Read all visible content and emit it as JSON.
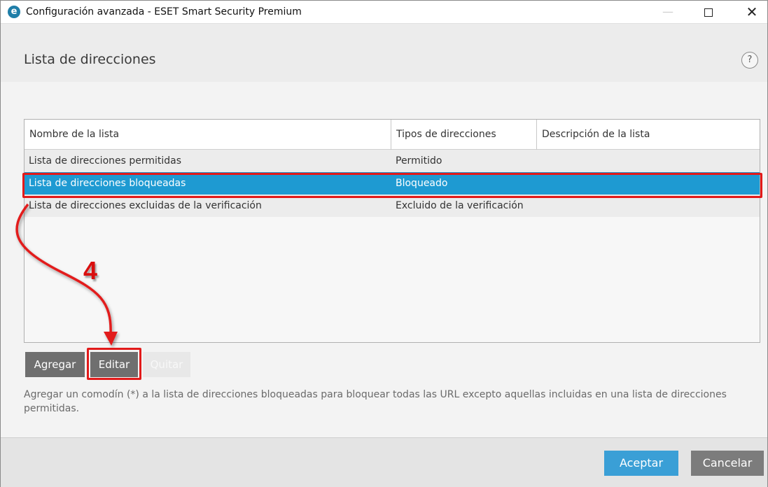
{
  "window": {
    "title": "Configuración avanzada - ESET Smart Security Premium",
    "logo_icon": "eset-logo-icon",
    "logo_glyph": "e",
    "controls": {
      "minimize": "—",
      "maximize": "",
      "close": "✕"
    }
  },
  "header": {
    "title": "Lista de direcciones",
    "help_glyph": "?"
  },
  "table": {
    "columns": [
      "Nombre de la lista",
      "Tipos de direcciones",
      "Descripción de la lista"
    ],
    "rows": [
      {
        "name": "Lista de direcciones permitidas",
        "type": "Permitido",
        "description": "",
        "selected": false
      },
      {
        "name": "Lista de direcciones bloqueadas",
        "type": "Bloqueado",
        "description": "",
        "selected": true
      },
      {
        "name": "Lista de direcciones excluidas de la verificación",
        "type": "Excluido de la verificación",
        "description": "",
        "selected": false
      }
    ]
  },
  "buttons": {
    "add": "Agregar",
    "edit": "Editar",
    "remove": "Quitar"
  },
  "hint": "Agregar un comodín (*) a la lista de direcciones bloqueadas para bloquear todas las URL excepto aquellas incluidas en una lista de direcciones permitidas.",
  "footer": {
    "ok": "Aceptar",
    "cancel": "Cancelar"
  },
  "annotation": {
    "step": "4",
    "color": "#e21a1a"
  },
  "colors": {
    "selected_row": "#1e9ad2",
    "primary_button": "#3a9fd6",
    "secondary_button": "#7c7c7c"
  }
}
